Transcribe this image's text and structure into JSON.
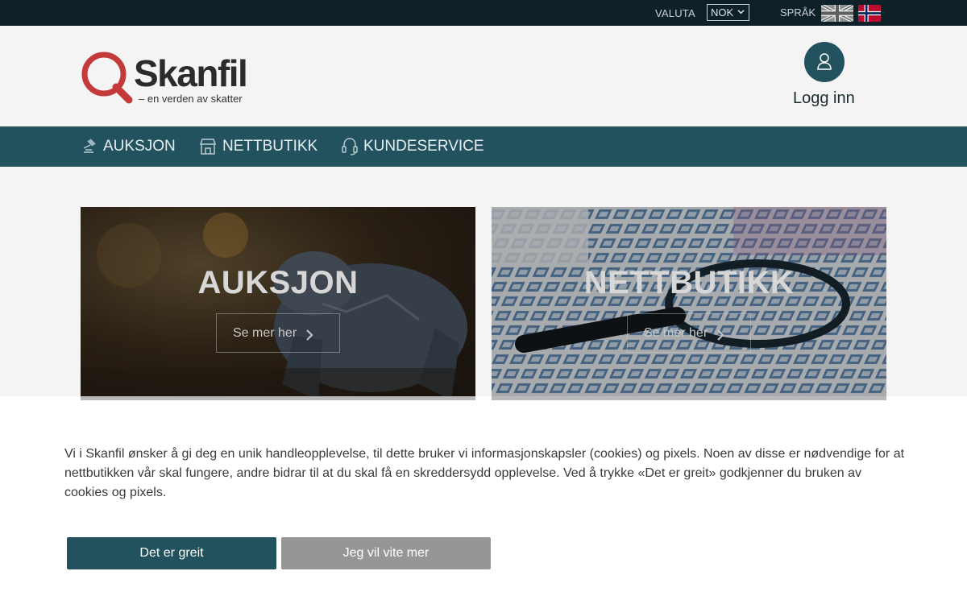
{
  "topbar": {
    "currency_label": "VALUTA",
    "currency_value": "NOK",
    "language_label": "SPRÅK",
    "flags": [
      "uk-flag-icon",
      "norway-flag-icon"
    ]
  },
  "header": {
    "logo_brand": "Skanfil",
    "logo_tagline": "– en verden av skatter",
    "login_label": "Logg inn"
  },
  "nav": {
    "items": [
      {
        "label": "AUKSJON",
        "icon": "gavel-icon"
      },
      {
        "label": "NETTBUTIKK",
        "icon": "storefront-icon"
      },
      {
        "label": "KUNDESERVICE",
        "icon": "headset-icon"
      }
    ]
  },
  "cards": [
    {
      "title": "AUKSJON",
      "button_label": "Se mer her"
    },
    {
      "title": "NETTBUTIKK",
      "button_label": "Se mer her"
    }
  ],
  "cookie": {
    "text": "Vi i Skanfil ønsker å gi deg en unik handleopplevelse, til dette bruker vi informasjonskapsler (cookies) og pixels. Noen av disse er nødvendige for at nettbutikken vår skal fungere, andre bidrar til at du skal få en skreddersydd opplevelse. Ved å trykke «Det er greit» godkjenner du bruken av cookies og pixels.",
    "accept_label": "Det er greit",
    "more_label": "Jeg vil vite mer"
  },
  "colors": {
    "topbar_bg": "#0f2128",
    "brand_teal": "#23525f",
    "logo_red": "#c4393a",
    "header_bg": "#f4f4f4"
  }
}
